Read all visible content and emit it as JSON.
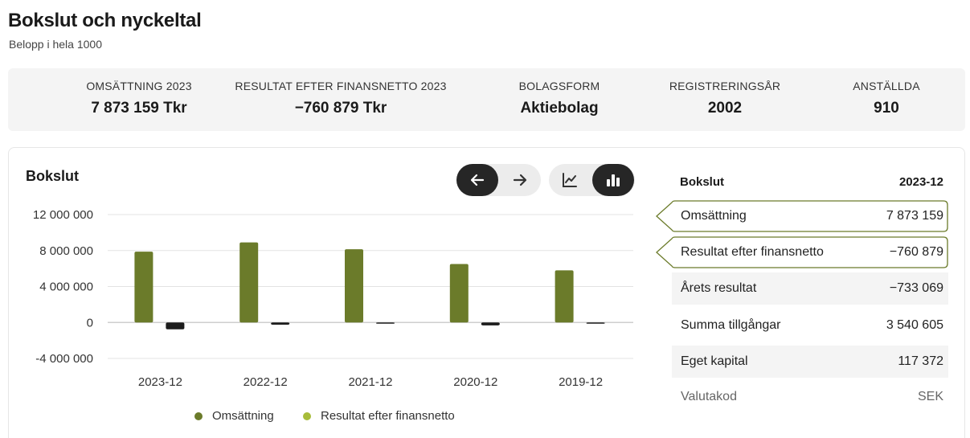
{
  "header": {
    "title": "Bokslut och nyckeltal",
    "subtitle": "Belopp i hela 1000"
  },
  "kpis": [
    {
      "label": "OMSÄTTNING 2023",
      "value": "7 873 159 Tkr"
    },
    {
      "label": "RESULTAT EFTER FINANSNETTO 2023",
      "value": "−760 879 Tkr"
    },
    {
      "label": "BOLAGSFORM",
      "value": "Aktiebolag"
    },
    {
      "label": "REGISTRERINGSÅR",
      "value": "2002"
    },
    {
      "label": "ANSTÄLLDA",
      "value": "910"
    }
  ],
  "chart_card": {
    "title": "Bokslut",
    "nav_buttons": [
      {
        "name": "previous",
        "icon": "arrow-left-icon",
        "active": true
      },
      {
        "name": "next",
        "icon": "arrow-right-icon",
        "active": false
      }
    ],
    "view_buttons": [
      {
        "name": "line-view",
        "icon": "line-chart-icon",
        "active": false
      },
      {
        "name": "bar-view",
        "icon": "bar-chart-icon",
        "active": true
      }
    ]
  },
  "chart_data": {
    "type": "bar",
    "categories": [
      "2023-12",
      "2022-12",
      "2021-12",
      "2020-12",
      "2019-12"
    ],
    "series": [
      {
        "name": "Omsättning",
        "color": "#6b7b2a",
        "values": [
          7873159,
          8900000,
          8150000,
          6500000,
          5800000
        ]
      },
      {
        "name": "Resultat efter finansnetto",
        "color": "#1c1c1c",
        "values": [
          -760879,
          -250000,
          -60000,
          -320000,
          -40000
        ]
      }
    ],
    "y_ticks": [
      "12 000 000",
      "8 000 000",
      "4 000 000",
      "0",
      "-4 000 000"
    ],
    "ylim": [
      -4000000,
      12000000
    ],
    "grid": true,
    "legend": {
      "position": "bottom",
      "items": [
        {
          "label": "Omsättning",
          "color": "#6b7b2a"
        },
        {
          "label": "Resultat efter finansnetto",
          "color": "#a7bc3a"
        }
      ]
    }
  },
  "table": {
    "header_label": "Bokslut",
    "header_value": "2023-12",
    "rows": [
      {
        "label": "Omsättning",
        "value": "7 873 159",
        "style": "selected"
      },
      {
        "label": "Resultat efter finansnetto",
        "value": "−760 879",
        "style": "selected"
      },
      {
        "label": "Årets resultat",
        "value": "−733 069",
        "style": "shaded"
      },
      {
        "label": "Summa tillgångar",
        "value": "3 540 605",
        "style": "plain"
      },
      {
        "label": "Eget kapital",
        "value": "117 372",
        "style": "shaded"
      },
      {
        "label": "Valutakod",
        "value": "SEK",
        "style": "muted"
      }
    ]
  },
  "colors": {
    "accent": "#6b7b2a",
    "accent_light": "#a7bc3a",
    "dark": "#262626"
  }
}
